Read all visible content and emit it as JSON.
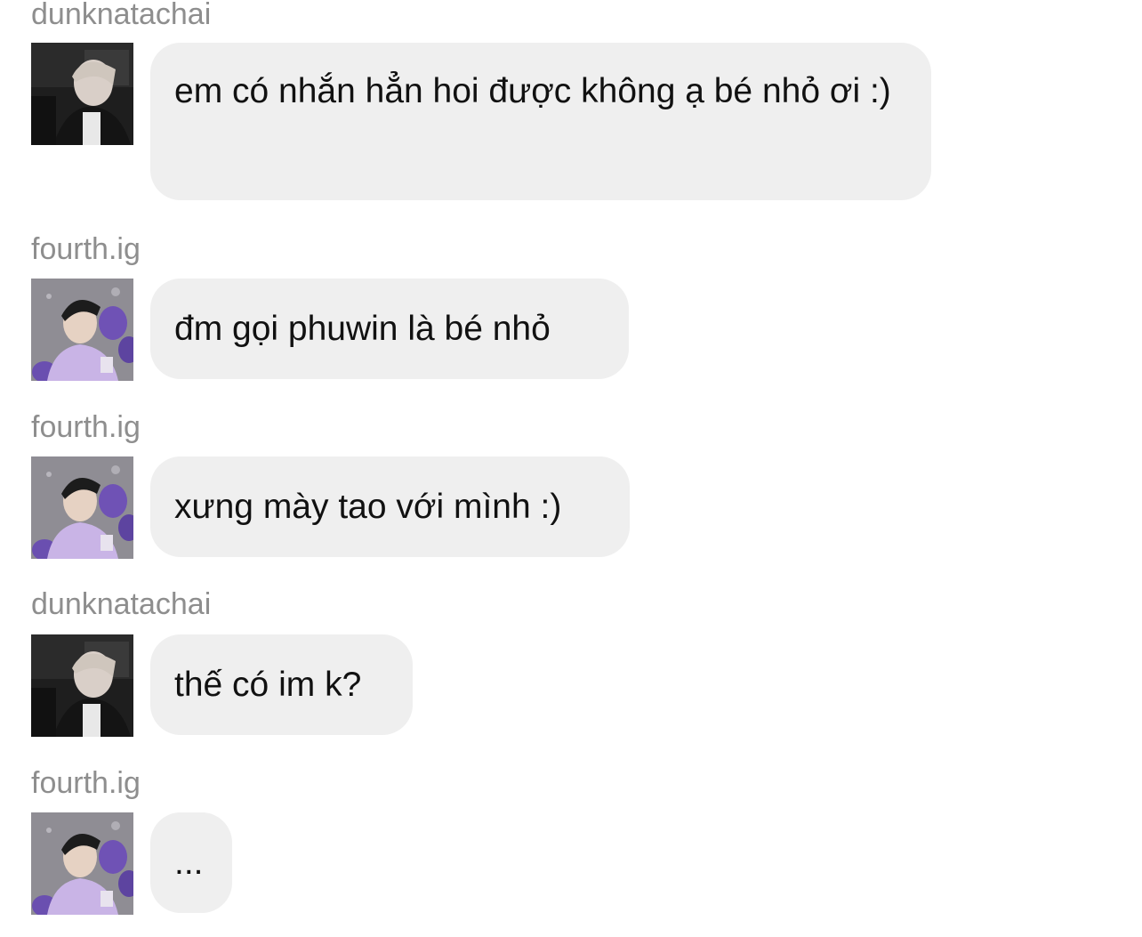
{
  "messages": [
    {
      "username": "dunknatachai",
      "avatar": "dunk",
      "text": "em có nhắn hẳn hoi được không ạ bé nhỏ ơi :)"
    },
    {
      "username": "fourth.ig",
      "avatar": "fourth",
      "text": "đm gọi phuwin là bé nhỏ"
    },
    {
      "username": "fourth.ig",
      "avatar": "fourth",
      "text": "xưng mày tao với mình :)"
    },
    {
      "username": "dunknatachai",
      "avatar": "dunk",
      "text": "thế có im k?"
    },
    {
      "username": "fourth.ig",
      "avatar": "fourth",
      "text": "..."
    }
  ]
}
